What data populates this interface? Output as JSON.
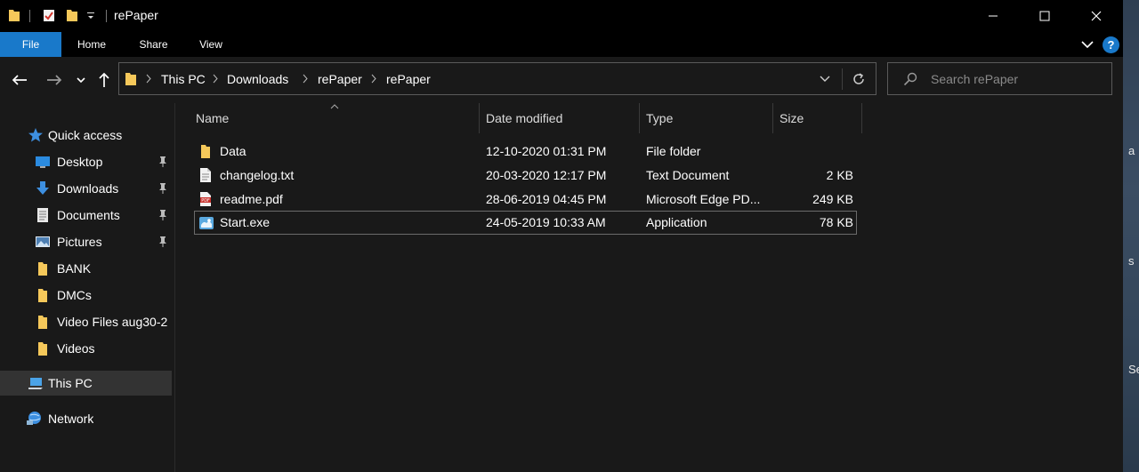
{
  "window": {
    "title": "rePaper"
  },
  "ribbon": {
    "tabs": [
      "File",
      "Home",
      "Share",
      "View"
    ],
    "help_label": "?"
  },
  "navigation": {
    "breadcrumbs": [
      "This PC",
      "Downloads",
      "rePaper",
      "rePaper"
    ]
  },
  "search": {
    "placeholder": "Search rePaper"
  },
  "sidebar": {
    "items": [
      {
        "label": "Quick access",
        "icon": "star-icon"
      },
      {
        "label": "Desktop",
        "icon": "desktop-icon",
        "pinned": true
      },
      {
        "label": "Downloads",
        "icon": "download-arrow-icon",
        "pinned": true
      },
      {
        "label": "Documents",
        "icon": "documents-icon",
        "pinned": true
      },
      {
        "label": "Pictures",
        "icon": "pictures-icon",
        "pinned": true
      },
      {
        "label": "BANK",
        "icon": "folder-icon"
      },
      {
        "label": "DMCs",
        "icon": "folder-icon"
      },
      {
        "label": "Video Files aug30-2",
        "icon": "folder-icon"
      },
      {
        "label": "Videos",
        "icon": "folder-icon"
      },
      {
        "label": "This PC",
        "icon": "computer-icon",
        "selected": true
      },
      {
        "label": "Network",
        "icon": "network-icon"
      }
    ]
  },
  "file_list": {
    "columns": [
      "Name",
      "Date modified",
      "Type",
      "Size"
    ],
    "rows": [
      {
        "name": "Data",
        "date": "12-10-2020 01:31 PM",
        "type": "File folder",
        "size": "",
        "icon": "folder-icon"
      },
      {
        "name": "changelog.txt",
        "date": "20-03-2020 12:17 PM",
        "type": "Text Document",
        "size": "2 KB",
        "icon": "text-file-icon"
      },
      {
        "name": "readme.pdf",
        "date": "28-06-2019 04:45 PM",
        "type": "Microsoft Edge PD...",
        "size": "249 KB",
        "icon": "pdf-file-icon"
      },
      {
        "name": "Start.exe",
        "date": "24-05-2019 10:33 AM",
        "type": "Application",
        "size": "78 KB",
        "icon": "application-icon",
        "selected": true
      }
    ]
  },
  "desktop_peek": {
    "fragments": [
      "a",
      "s",
      "Se"
    ]
  },
  "colors": {
    "accent": "#1979ca",
    "folder": "#f5c85a",
    "background": "#191919"
  }
}
